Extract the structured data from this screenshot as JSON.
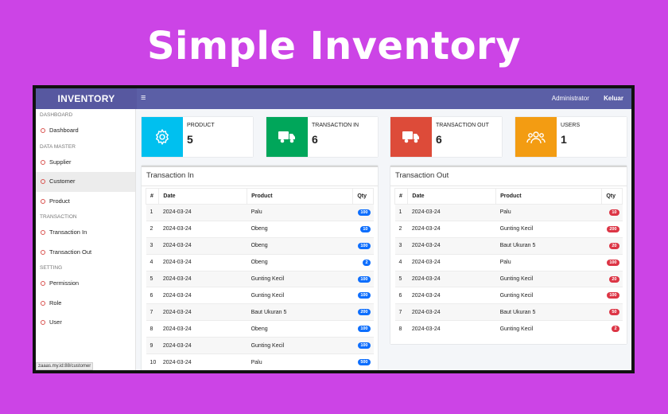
{
  "hero": {
    "title": "Simple Inventory"
  },
  "topbar": {
    "brand": "INVENTORY",
    "menu_icon": "≡",
    "user": "Administrator",
    "logout": "Keluar"
  },
  "sidebar": {
    "sections": [
      {
        "header": "DASHBOARD",
        "items": [
          {
            "label": "Dashboard"
          }
        ]
      },
      {
        "header": "DATA MASTER",
        "items": [
          {
            "label": "Supplier"
          },
          {
            "label": "Customer"
          },
          {
            "label": "Product"
          }
        ]
      },
      {
        "header": "TRANSACTION",
        "items": [
          {
            "label": "Transaction In"
          },
          {
            "label": "Transaction Out"
          }
        ]
      },
      {
        "header": "SETTING",
        "items": [
          {
            "label": "Permission"
          },
          {
            "label": "Role"
          },
          {
            "label": "User"
          }
        ]
      }
    ],
    "active": "Customer",
    "status_url": "zaaas.my.id:88/customer"
  },
  "stats": [
    {
      "label": "PRODUCT",
      "value": "5",
      "color": "#00c0ef",
      "icon": "gear-icon"
    },
    {
      "label": "TRANSACTION IN",
      "value": "6",
      "color": "#00a65a",
      "icon": "truck-icon"
    },
    {
      "label": "TRANSACTION OUT",
      "value": "6",
      "color": "#dd4b39",
      "icon": "truck-icon"
    },
    {
      "label": "USERS",
      "value": "1",
      "color": "#f39c12",
      "icon": "users-icon"
    }
  ],
  "transaction_in": {
    "title": "Transaction In",
    "columns": [
      "#",
      "Date",
      "Product",
      "Qty"
    ],
    "badge_color": "#0d6efd",
    "rows": [
      [
        "1",
        "2024-03-24",
        "Palu",
        "100"
      ],
      [
        "2",
        "2024-03-24",
        "Obeng",
        "10"
      ],
      [
        "3",
        "2024-03-24",
        "Obeng",
        "100"
      ],
      [
        "4",
        "2024-03-24",
        "Obeng",
        "2"
      ],
      [
        "5",
        "2024-03-24",
        "Gunting Kecil",
        "100"
      ],
      [
        "6",
        "2024-03-24",
        "Gunting Kecil",
        "100"
      ],
      [
        "7",
        "2024-03-24",
        "Baut Ukuran 5",
        "200"
      ],
      [
        "8",
        "2024-03-24",
        "Obeng",
        "100"
      ],
      [
        "9",
        "2024-03-24",
        "Gunting Kecil",
        "100"
      ],
      [
        "10",
        "2024-03-24",
        "Palu",
        "500"
      ]
    ]
  },
  "transaction_out": {
    "title": "Transaction Out",
    "columns": [
      "#",
      "Date",
      "Product",
      "Qty"
    ],
    "badge_color": "#dc3545",
    "rows": [
      [
        "1",
        "2024-03-24",
        "Palu",
        "10"
      ],
      [
        "2",
        "2024-03-24",
        "Gunting Kecil",
        "200"
      ],
      [
        "3",
        "2024-03-24",
        "Baut Ukuran 5",
        "20"
      ],
      [
        "4",
        "2024-03-24",
        "Palu",
        "100"
      ],
      [
        "5",
        "2024-03-24",
        "Gunting Kecil",
        "20"
      ],
      [
        "6",
        "2024-03-24",
        "Gunting Kecil",
        "100"
      ],
      [
        "7",
        "2024-03-24",
        "Baut Ukuran 5",
        "50"
      ],
      [
        "8",
        "2024-03-24",
        "Gunting Kecil",
        "2"
      ]
    ]
  }
}
